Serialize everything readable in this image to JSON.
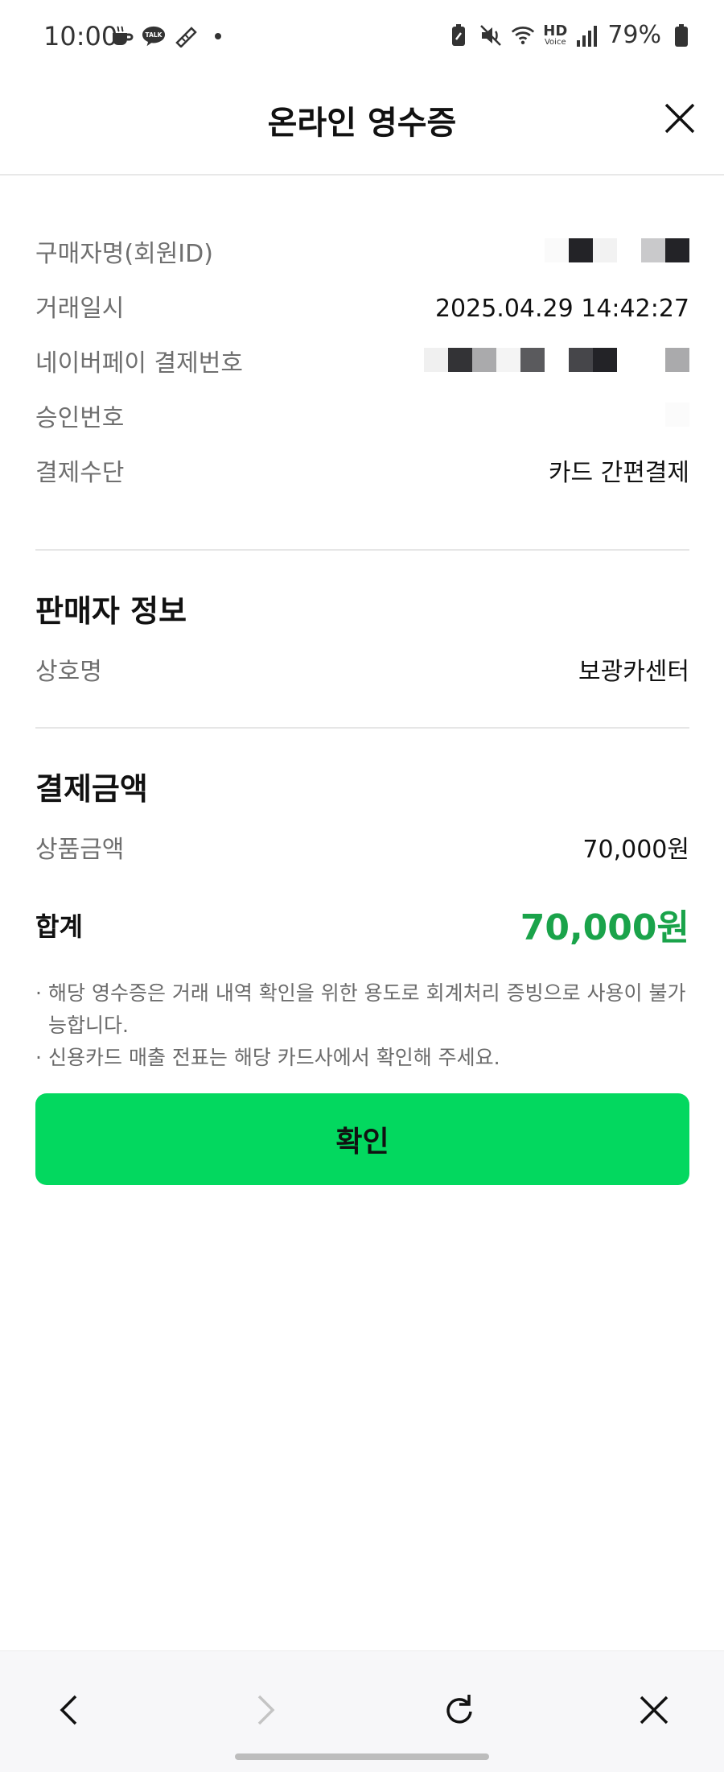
{
  "status_bar": {
    "time": "10:00",
    "left_icons": [
      "coffee-icon",
      "kakaotalk-icon",
      "ticket-icon",
      "dot-icon"
    ],
    "right_icons": [
      "battery-saver-icon",
      "mute-icon",
      "wifi-icon",
      "hd-voice-icon",
      "signal-icon"
    ],
    "hd_voice_text": "HD",
    "voice_text": "Voice",
    "battery": "79%"
  },
  "header": {
    "title": "온라인 영수증",
    "close_icon": "close-icon"
  },
  "purchase_info": {
    "buyer_label": "구매자명(회원ID)",
    "transaction_date_label": "거래일시",
    "transaction_date_value": "2025.04.29 14:42:27",
    "naverpay_number_label": "네이버페이 결제번호",
    "approval_number_label": "승인번호",
    "payment_method_label": "결제수단",
    "payment_method_value": "카드 간편결제"
  },
  "seller_info": {
    "section_title": "판매자 정보",
    "business_name_label": "상호명",
    "business_name_value": "보광카센터"
  },
  "payment_amount": {
    "section_title": "결제금액",
    "product_amount_label": "상품금액",
    "product_amount_value": "70,000원",
    "total_label": "합계",
    "total_value": "70,000원"
  },
  "notes": [
    "해당 영수증은 거래 내역 확인을 위한 용도로 회계처리 증빙으로 사용이 불가능합니다.",
    "신용카드 매출 전표는 해당 카드사에서 확인해 주세요."
  ],
  "confirm_button": "확인",
  "colors": {
    "accent_green": "#03d85f",
    "total_green": "#1aa34a",
    "label_gray": "#6f6f6f"
  },
  "bottom_nav": {
    "icons": [
      "back-icon",
      "forward-icon",
      "refresh-icon",
      "close-icon"
    ]
  }
}
